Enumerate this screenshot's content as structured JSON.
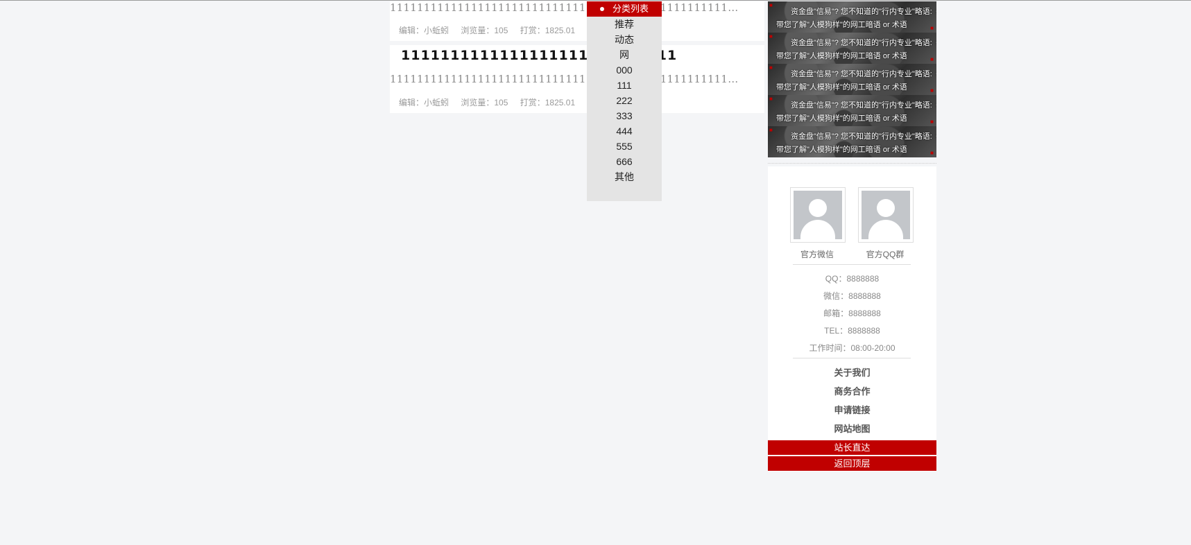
{
  "articles": [
    {
      "title": "",
      "summary": "111111111111111111111111111111111111111111111111111111111111111111...",
      "meta": {
        "editor": "编辑：小蚯蚓",
        "views": "浏览量：105",
        "reward": "打赏：1825.01"
      }
    },
    {
      "title": "1111111111111111111111111111",
      "summary": "111111111111111111111111111111111111111111111111111111111111111111...",
      "meta": {
        "editor": "编辑：小蚯蚓",
        "views": "浏览量：105",
        "reward": "打赏：1825.01"
      }
    }
  ],
  "category_menu": {
    "header": "分类列表",
    "items": [
      "推荐",
      "动态",
      "网",
      "000",
      "111",
      "222",
      "333",
      "444",
      "555",
      "666",
      "其他"
    ]
  },
  "banners": [
    {
      "line1": "资金盘\"信易\"? 您不知道的\"行内专业\"略语:《圈内术语大全》",
      "line2": "带您了解\"人模狗样\"的网工暗语 or 术语"
    },
    {
      "line1": "资金盘\"信易\"? 您不知道的\"行内专业\"略语:《圈内术语大全》",
      "line2": "带您了解\"人模狗样\"的网工暗语 or 术语"
    },
    {
      "line1": "资金盘\"信易\"? 您不知道的\"行内专业\"略语:《圈内术语大全》",
      "line2": "带您了解\"人模狗样\"的网工暗语 or 术语"
    },
    {
      "line1": "资金盘\"信易\"? 您不知道的\"行内专业\"略语:《圈内术语大全》",
      "line2": "带您了解\"人模狗样\"的网工暗语 or 术语"
    },
    {
      "line1": "资金盘\"信易\"? 您不知道的\"行内专业\"略语:《圈内术语大全》",
      "line2": "带您了解\"人模狗样\"的网工暗语 or 术语"
    }
  ],
  "sidebar": {
    "qr_captions": [
      "官方微信",
      "官方QQ群"
    ],
    "contacts": [
      "QQ：8888888",
      "微信：8888888",
      "邮箱：8888888",
      "TEL：8888888",
      "工作时间：08:00-20:00"
    ],
    "links": [
      "关于我们",
      "商务合作",
      "申请链接",
      "网站地图"
    ],
    "buttons": [
      "站长直达",
      "返回顶层"
    ]
  },
  "colors": {
    "accent": "#c00000",
    "background": "#f4f5f7",
    "menu_bg": "#e4e4e4"
  }
}
